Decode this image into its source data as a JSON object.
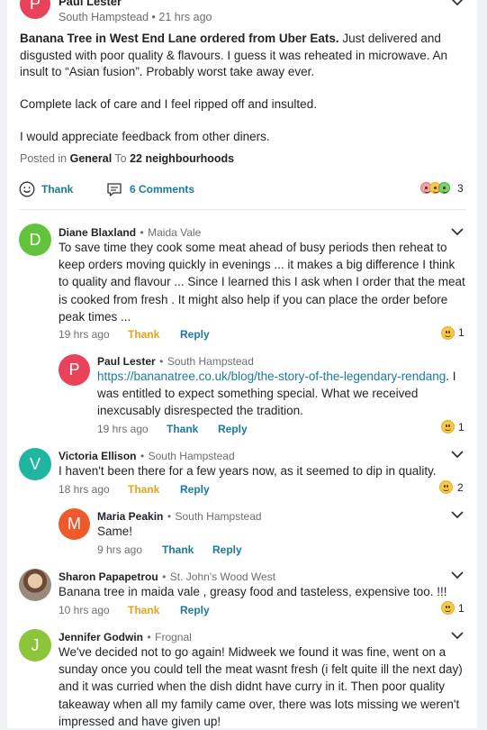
{
  "post": {
    "author": "Paul Lester",
    "author_initial": "P",
    "location": "South Hampstead",
    "time": "21 hrs ago",
    "title": "Banana Tree in West End Lane ordered from Uber Eats.",
    "body_1": "Just delivered and disgusted with poor quality & flavours. I guess it was reheated in microwave. An insult to “Asian fusion”. Probably worst take away ever.",
    "body_2": "Complete lack of care and I feel ripped off and insulted.",
    "body_3": "I would appreciate feedback from other diners.",
    "posted_in_prefix": "Posted in",
    "category": "General",
    "to_label": "To",
    "audience": "22 neighbourhoods",
    "thank_label": "Thank",
    "comments_label": "6 Comments",
    "reaction_count": "3"
  },
  "comments": [
    {
      "author": "Diane Blaxland",
      "initial": "D",
      "location": "Maida Vale",
      "text": "To save time they cook some meat ahead of busy periods then reheat to keep orders moving quickly in evenings ... it makes a big difference I think to quality and flavour ... Since I learned this I ask when I order that the meat is cooked from fresh .  It might also help if you can place the order before peak times ...",
      "time": "19 hrs ago",
      "thank": "Thank",
      "reply": "Reply",
      "reactions": "1"
    },
    {
      "author": "Paul Lester",
      "initial": "P",
      "location": "South Hampstead",
      "link": "https://bananatree.co.uk/blog/the-story-of-the-legendary-rendang",
      "text": ". I was entitled to expect something special. What we received inexcusably disrespected the tradition.",
      "time": "19 hrs ago",
      "thank": "Thank",
      "reply": "Reply",
      "reactions": "1"
    },
    {
      "author": "Victoria Ellison",
      "initial": "V",
      "location": "South Hampstead",
      "text": "I haven't been there for a few years now, as it seemed to dip in quality.",
      "time": "18 hrs ago",
      "thank": "Thank",
      "reply": "Reply",
      "reactions": "2"
    },
    {
      "author": "Maria Peakin",
      "initial": "M",
      "location": "South Hampstead",
      "text": "Same!",
      "time": "9 hrs ago",
      "thank": "Thank",
      "reply": "Reply"
    },
    {
      "author": "Sharon Papapetrou",
      "location": "St. John's Wood West",
      "text": "Banana tree in maida vale , greasy food and tasteless, expensive too. !!!",
      "time": "10 hrs ago",
      "thank": "Thank",
      "reply": "Reply",
      "reactions": "1"
    },
    {
      "author": "Jennifer Godwin",
      "initial": "J",
      "location": "Frognal",
      "text": "We've decided not to go again! Midweek we found it was fine, went on a sunday once you could tell the meat wasnt fresh (i felt quite ill the next day) and it was curried when the dish didnt have curry in it. Then poor quality takeaway when all my family came over, there was lots missing we weren't impressed and have given up!"
    }
  ],
  "separator": "•",
  "colors": {
    "paul": "#e8435a",
    "diane": "#62c43c",
    "victoria": "#1fb5a0",
    "maria": "#ef5a2a",
    "jennifer": "#8cc43a",
    "link": "#1c7a9e",
    "thank_orange": "#e2a51a"
  },
  "icons": [
    "chevron-down-icon",
    "smiley-icon",
    "comment-icon",
    "reaction-emoji-icon"
  ]
}
